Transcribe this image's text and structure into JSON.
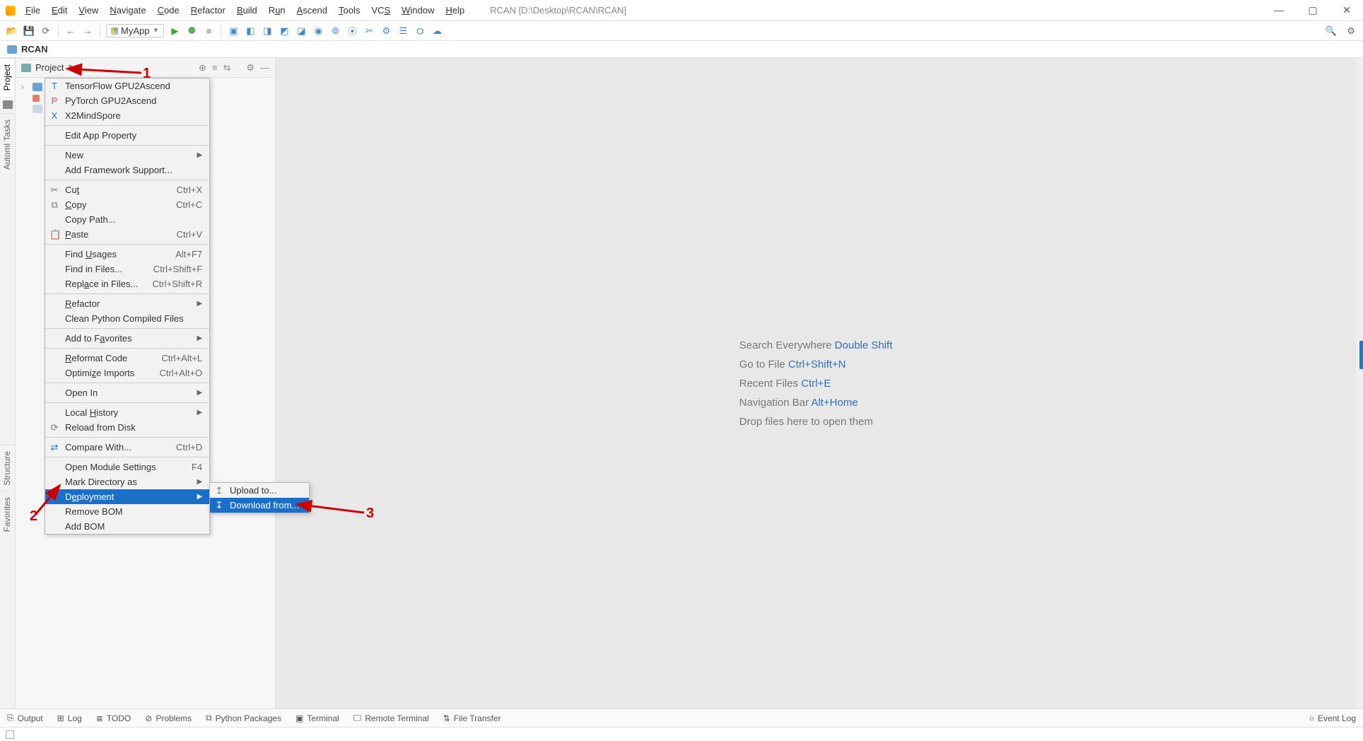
{
  "title": "RCAN [D:\\Desktop\\RCAN\\RCAN]",
  "menus": [
    "File",
    "Edit",
    "View",
    "Navigate",
    "Code",
    "Refactor",
    "Build",
    "Run",
    "Ascend",
    "Tools",
    "VCS",
    "Window",
    "Help"
  ],
  "runConfig": "MyApp",
  "breadcrumb": "RCAN",
  "projectPanel": {
    "title": "Project"
  },
  "welcome": {
    "searchEverywhere": "Search Everywhere ",
    "searchEverywhereKey": "Double Shift",
    "goToFile": "Go to File ",
    "goToFileKey": "Ctrl+Shift+N",
    "recentFiles": "Recent Files ",
    "recentFilesKey": "Ctrl+E",
    "navBar": "Navigation Bar ",
    "navBarKey": "Alt+Home",
    "drop": "Drop files here to open them"
  },
  "leftTabs": {
    "project": "Project",
    "automl": "Automl Tasks",
    "structure": "Structure",
    "favorites": "Favorites"
  },
  "bottom": {
    "output": "Output",
    "log": "Log",
    "todo": "TODO",
    "problems": "Problems",
    "pypkg": "Python Packages",
    "terminal": "Terminal",
    "remote": "Remote Terminal",
    "filetransfer": "File Transfer",
    "eventlog": "Event Log"
  },
  "ctx": {
    "tfAscend": "TensorFlow GPU2Ascend",
    "ptAscend": "PyTorch GPU2Ascend",
    "x2mind": "X2MindSpore",
    "editApp": "Edit App Property",
    "new": "New",
    "addFw": "Add Framework Support...",
    "cut": "Cut",
    "cutK": "Ctrl+X",
    "copy": "Copy",
    "copyK": "Ctrl+C",
    "copyPath": "Copy Path...",
    "paste": "Paste",
    "pasteK": "Ctrl+V",
    "findUsages": "Find Usages",
    "findUsagesK": "Alt+F7",
    "findInFiles": "Find in Files...",
    "findInFilesK": "Ctrl+Shift+F",
    "replaceInFiles": "Replace in Files...",
    "replaceInFilesK": "Ctrl+Shift+R",
    "refactor": "Refactor",
    "cleanPyc": "Clean Python Compiled Files",
    "addFav": "Add to Favorites",
    "reformat": "Reformat Code",
    "reformatK": "Ctrl+Alt+L",
    "optImports": "Optimize Imports",
    "optImportsK": "Ctrl+Alt+O",
    "openIn": "Open In",
    "localHistory": "Local History",
    "reload": "Reload from Disk",
    "compare": "Compare With...",
    "compareK": "Ctrl+D",
    "openModule": "Open Module Settings",
    "openModuleK": "F4",
    "markDir": "Mark Directory as",
    "deployment": "Deployment",
    "removeBom": "Remove BOM",
    "addBom": "Add BOM",
    "upload": "Upload to...",
    "download": "Download from..."
  },
  "annotations": {
    "a1": "1",
    "a2": "2",
    "a3": "3"
  }
}
